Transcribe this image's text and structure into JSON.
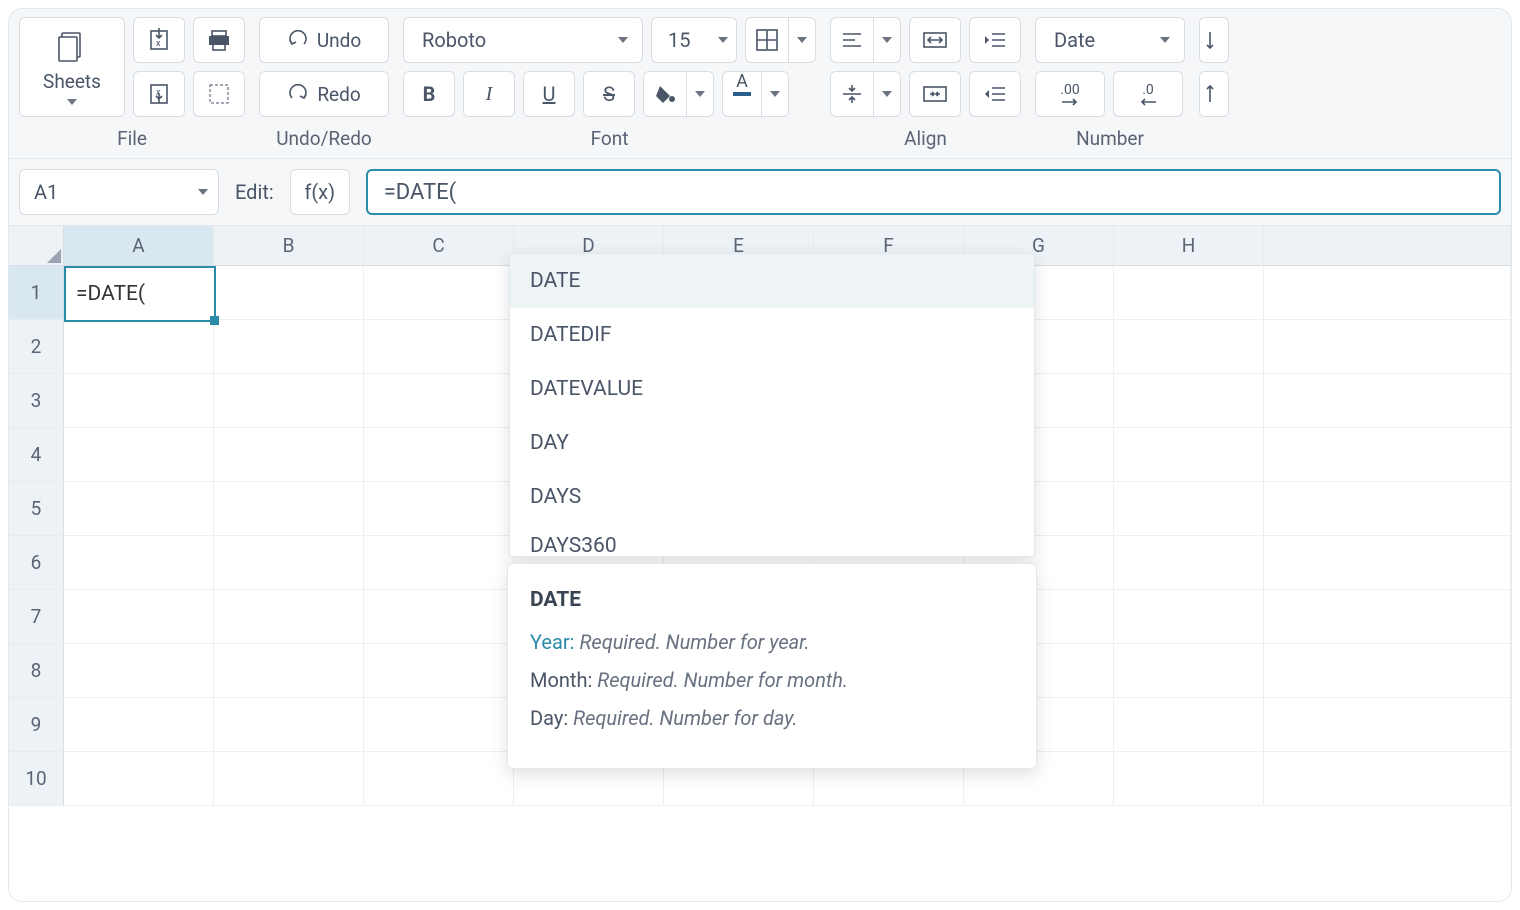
{
  "ribbon": {
    "sheets_label": "Sheets",
    "undo_label": "Undo",
    "redo_label": "Redo",
    "font_name": "Roboto",
    "font_size": "15",
    "number_format": "Date",
    "groups": {
      "file": "File",
      "undo": "Undo/Redo",
      "font": "Font",
      "align": "Align",
      "number": "Number"
    },
    "style": {
      "bold": "B",
      "italic": "I",
      "underline": "U",
      "strike": "S"
    },
    "fontcolor_accent": "#2b5f8a",
    "fillcolor_accent": "#e06b3e",
    "decimals_inc": ".00",
    "decimals_dec": ".0"
  },
  "formula_bar": {
    "cell_ref": "A1",
    "edit_label": "Edit:",
    "fx_label": "f(x)",
    "formula": "=DATE("
  },
  "grid": {
    "columns": [
      "A",
      "B",
      "C",
      "D",
      "E",
      "F",
      "G",
      "H"
    ],
    "rows": [
      1,
      2,
      3,
      4,
      5,
      6,
      7,
      8,
      9,
      10
    ],
    "active_cell_value": "=DATE("
  },
  "autocomplete": {
    "items": [
      {
        "label": "DATE",
        "selected": true
      },
      {
        "label": "DATEDIF",
        "selected": false
      },
      {
        "label": "DATEVALUE",
        "selected": false
      },
      {
        "label": "DAY",
        "selected": false
      },
      {
        "label": "DAYS",
        "selected": false
      },
      {
        "label": "DAYS360",
        "selected": false
      }
    ]
  },
  "tooltip": {
    "title": "DATE",
    "params": [
      {
        "name": "Year:",
        "desc": "Required. Number for year.",
        "highlight": true
      },
      {
        "name": "Month:",
        "desc": "Required. Number for month.",
        "highlight": false
      },
      {
        "name": "Day:",
        "desc": "Required. Number for day.",
        "highlight": false
      }
    ]
  }
}
